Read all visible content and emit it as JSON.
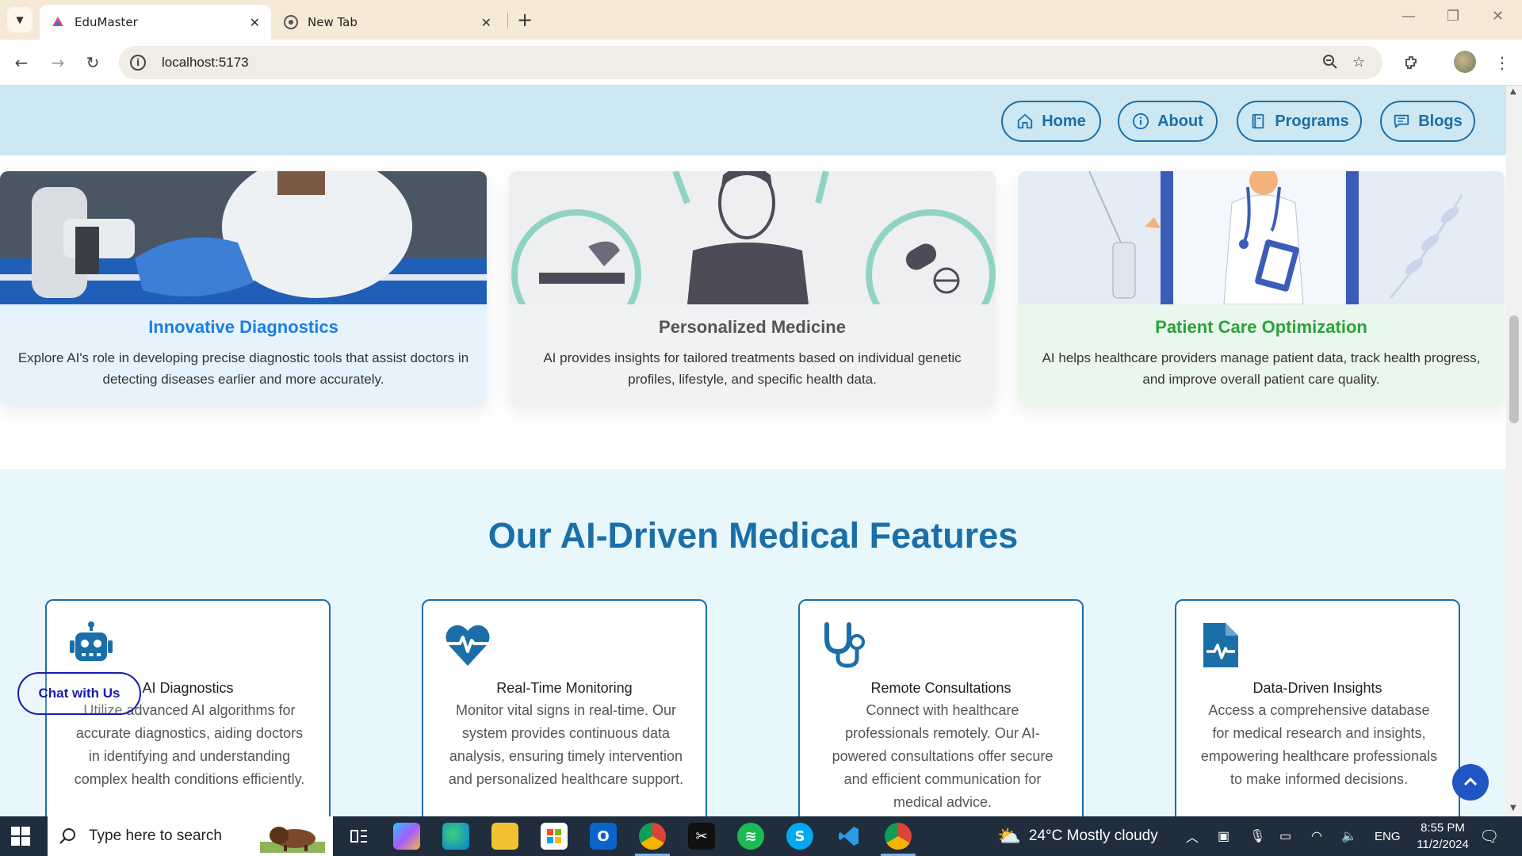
{
  "browser": {
    "tabs": [
      {
        "title": "EduMaster",
        "active": true
      },
      {
        "title": "New Tab",
        "active": false
      }
    ],
    "url": "localhost:5173"
  },
  "nav": {
    "items": [
      {
        "label": "Home",
        "icon": "home-icon"
      },
      {
        "label": "About",
        "icon": "info-icon"
      },
      {
        "label": "Programs",
        "icon": "book-icon"
      },
      {
        "label": "Blogs",
        "icon": "chat-icon"
      }
    ]
  },
  "top_cards": [
    {
      "title": "Innovative Diagnostics",
      "text": "Explore AI's role in developing precise diagnostic tools that assist doctors in detecting diseases earlier and more accurately.",
      "title_color": "#1a7fe0",
      "bg": "#e6f3fd"
    },
    {
      "title": "Personalized Medicine",
      "text": "AI provides insights for tailored treatments based on individual genetic profiles, lifestyle, and specific health data.",
      "title_color": "#555555",
      "bg": "#f1f2f3"
    },
    {
      "title": "Patient Care Optimization",
      "text": "AI helps healthcare providers manage patient data, track health progress, and improve overall patient care quality.",
      "title_color": "#2aa33a",
      "bg": "#eaf7ec"
    }
  ],
  "features": {
    "heading": "Our AI-Driven Medical Features",
    "cards": [
      {
        "title": "AI Diagnostics",
        "text": "Utilize advanced AI algorithms for accurate diagnostics, aiding doctors in identifying and understanding complex health conditions efficiently.",
        "icon": "robot-icon"
      },
      {
        "title": "Real-Time Monitoring",
        "text": "Monitor vital signs in real-time. Our system provides continuous data analysis, ensuring timely intervention and personalized healthcare support.",
        "icon": "heartbeat-icon"
      },
      {
        "title": "Remote Consultations",
        "text": "Connect with healthcare professionals remotely. Our AI-powered consultations offer secure and efficient communication for medical advice.",
        "icon": "stethoscope-icon"
      },
      {
        "title": "Data-Driven Insights",
        "text": "Access a comprehensive database for medical research and insights, empowering healthcare professionals to make informed decisions.",
        "icon": "file-medical-icon"
      }
    ]
  },
  "chat_button": "Chat with Us",
  "taskbar": {
    "search_placeholder": "Type here to search",
    "weather": "24°C  Mostly cloudy",
    "language": "ENG",
    "time": "8:55 PM",
    "date": "11/2/2024"
  },
  "colors": {
    "accent": "#1b6fa8",
    "nav_bg": "#cde8f3",
    "features_bg": "#e8f7fc"
  }
}
